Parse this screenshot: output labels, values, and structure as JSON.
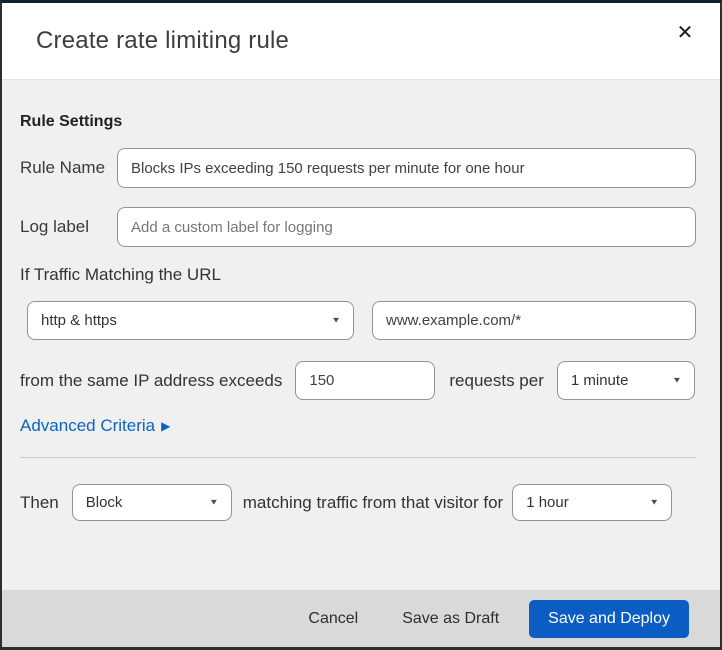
{
  "modal": {
    "title": "Create rate limiting rule"
  },
  "icons": {
    "close": "✕",
    "caret_down": "▼",
    "arrow_right": "▶"
  },
  "form": {
    "section_heading": "Rule Settings",
    "rule_name": {
      "label": "Rule Name",
      "value": "Blocks IPs exceeding 150 requests per minute for one hour"
    },
    "log_label": {
      "label": "Log label",
      "placeholder": "Add a custom label for logging"
    },
    "traffic_match": {
      "heading": "If Traffic Matching the URL",
      "scheme_selected": "http & https",
      "url_value": "www.example.com/*"
    },
    "rate": {
      "prefix": "from the same IP address exceeds",
      "threshold": "150",
      "middle": "requests per",
      "period_selected": "1 minute"
    },
    "advanced_criteria": {
      "label": "Advanced Criteria"
    },
    "then": {
      "prefix": "Then",
      "action_selected": "Block",
      "middle": "matching traffic from that visitor for",
      "duration_selected": "1 hour"
    }
  },
  "footer": {
    "cancel_label": "Cancel",
    "save_draft_label": "Save as Draft",
    "save_deploy_label": "Save and Deploy"
  },
  "colors": {
    "primary_button_blue": "#0b5cc3",
    "link_blue": "#0a63c4",
    "body_background": "#f0f0f0",
    "footer_background": "#d9d9d9",
    "top_border_navy": "#0d2130"
  }
}
